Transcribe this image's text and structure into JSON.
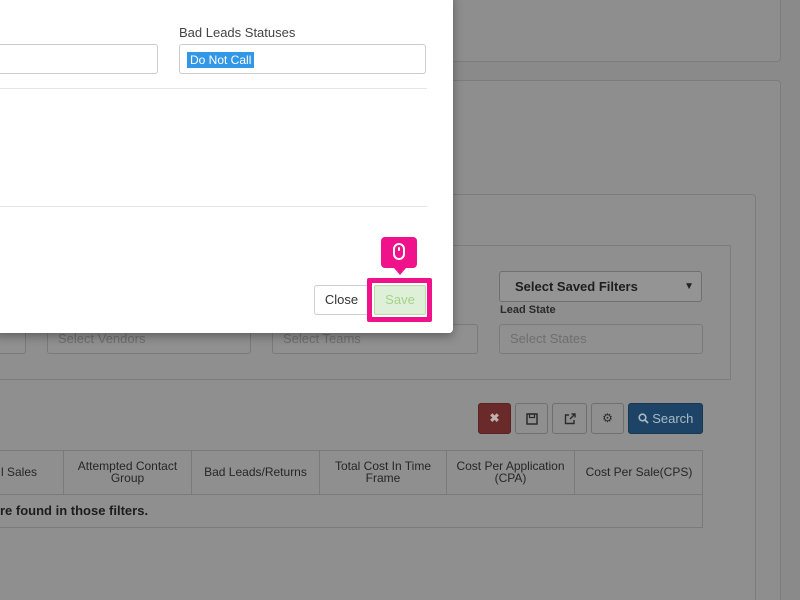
{
  "background": {
    "saved_filters_select": "Select Saved Filters",
    "lead_state_label": "Lead State",
    "placeholders": {
      "vendors": "Select Vendors",
      "teams": "Select Teams",
      "states": "Select States"
    },
    "toolbar": {
      "clear_icon": "times-icon",
      "save_icon": "floppy-disk-icon",
      "export_icon": "external-link-icon",
      "settings_icon": "gear-icon",
      "search_label": "Search"
    },
    "table": {
      "columns": [
        "l Sales",
        "Attempted Contact Group",
        "Bad Leads/Returns",
        "Total Cost In Time Frame",
        "Cost Per Application (CPA)",
        "Cost Per Sale(CPS)"
      ],
      "empty_message": "re found in those filters."
    }
  },
  "modal": {
    "bad_leads_label": "Bad Leads Statuses",
    "bad_leads_selected": "Do Not Call",
    "close_label": "Close",
    "save_label": "Save"
  },
  "highlight": {
    "color": "#f0128a",
    "icon": "mouse-icon"
  }
}
